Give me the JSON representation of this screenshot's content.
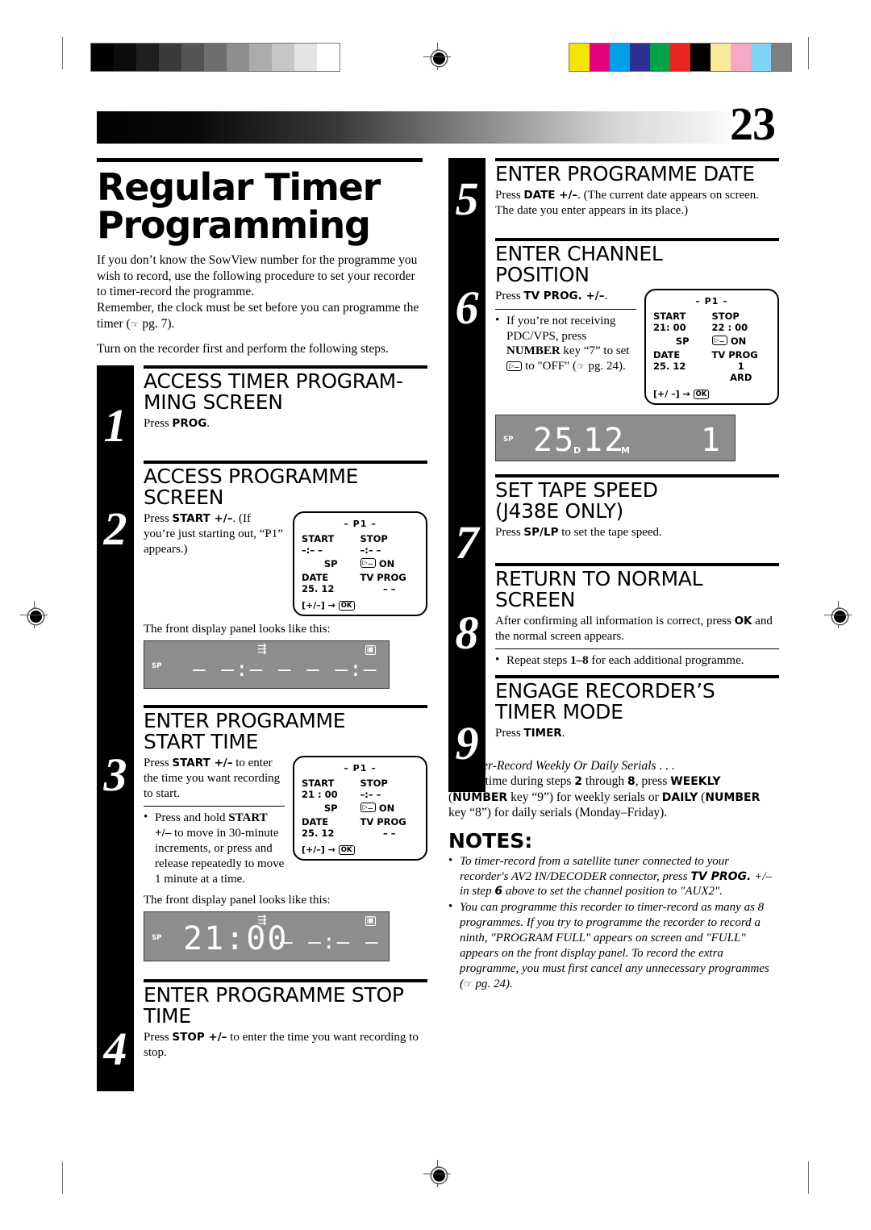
{
  "page": {
    "number": "23",
    "title_line1": "Regular Timer",
    "title_line2": "Programming"
  },
  "intro": {
    "para1": "If you don’t know the SowView number for the programme you wish to record, use the following procedure to set your recorder to timer-record the programme.",
    "para2": "Remember, the clock must be set before you can programme the timer (",
    "para2_ref": "pg. 7).",
    "para3": "Turn on the recorder first and perform the following steps."
  },
  "steps": [
    {
      "num": "1",
      "heading": "ACCESS TIMER PROGRAM-\nMING SCREEN",
      "body_pre": "Press ",
      "body_bold": "PROG",
      "body_post": "."
    },
    {
      "num": "2",
      "heading": "ACCESS PROGRAMME\nSCREEN",
      "body_pre": "Press ",
      "body_bold": "START +/–",
      "body_post": ". (If you’re just starting out, “P1” appears.)",
      "caption": "The front display panel looks like this:"
    },
    {
      "num": "3",
      "heading": "ENTER PROGRAMME\nSTART TIME",
      "body_pre": "Press ",
      "body_bold": "START +/–",
      "body_post": " to enter the time you want recording to start.",
      "bullet_pre": "Press and hold ",
      "bullet_bold": "START +/–",
      "bullet_post": " to move in 30-minute increments, or press and release repeatedly to move 1 minute at a time.",
      "caption": "The front display panel looks like this:"
    },
    {
      "num": "4",
      "heading": "ENTER PROGRAMME STOP\nTIME",
      "body_pre": "Press ",
      "body_bold": "STOP +/–",
      "body_post": " to enter the time you want recording to stop."
    },
    {
      "num": "5",
      "heading": "ENTER PROGRAMME DATE",
      "body_pre": "Press ",
      "body_bold": "DATE +/–",
      "body_post": ". (The current date appears on screen. The date you enter appears in its place.)"
    },
    {
      "num": "6",
      "heading": "ENTER CHANNEL\nPOSITION",
      "body_pre": "Press ",
      "body_bold": "TV PROG. +/–",
      "body_post": ".",
      "bullet_pre": "If you’re not receiving PDC/VPS, press ",
      "bullet_bold": "NUMBER",
      "bullet_post": " key “7” to set",
      "bullet_post2": "to \"OFF\" (",
      "bullet_ref": "pg. 24)."
    },
    {
      "num": "7",
      "heading": "SET TAPE SPEED\n(J438E ONLY)",
      "body_pre": "Press ",
      "body_bold": "SP/LP",
      "body_post": " to set the tape speed."
    },
    {
      "num": "8",
      "heading": "RETURN TO NORMAL\nSCREEN",
      "body_pre": "After confirming all information is correct, press ",
      "body_bold": "OK",
      "body_post": " and the normal screen appears.",
      "bullet_pre": "Repeat steps ",
      "bullet_bold": "1–8",
      "bullet_post": " for each additional programme."
    },
    {
      "num": "9",
      "heading": "ENGAGE RECORDER’S\nTIMER MODE",
      "body_pre": "Press ",
      "body_bold": "TIMER",
      "body_post": "."
    }
  ],
  "osd_step2": {
    "title": "– P1 –",
    "start_label": "START",
    "start_value": "–:– –",
    "stop_label": "STOP",
    "stop_value": "–:– –",
    "speed": "SP",
    "tape_icon": "tape-icon",
    "on_label": "ON",
    "date_label": "DATE",
    "date_value": "25. 12",
    "tvprog_label": "TV  PROG",
    "tvprog_value": "– –",
    "footer": "[+/–] →",
    "footer_icon": "OK"
  },
  "osd_step3": {
    "title": "– P1 –",
    "start_label": "START",
    "start_value": "21 : 00",
    "stop_label": "STOP",
    "stop_value": "–:– –",
    "speed": "SP",
    "tape_icon": "tape-icon",
    "on_label": "ON",
    "date_label": "DATE",
    "date_value": "25. 12",
    "tvprog_label": "TV  PROG",
    "tvprog_value": "– –",
    "footer": "[+/–] →",
    "footer_icon": "OK"
  },
  "osd_step6": {
    "title": "– P1 –",
    "start_label": "START",
    "start_value": "21: 00",
    "stop_label": "STOP",
    "stop_value": "22 : 00",
    "speed": "SP",
    "tape_icon": "tape-icon",
    "on_label": "ON",
    "date_label": "DATE",
    "date_value": "25. 12",
    "tvprog_label": "TV  PROG",
    "tvprog_value": "1",
    "tvprog_value2": "ARD",
    "footer": "[+/ –] →",
    "footer_icon": "OK"
  },
  "lcd_step2": {
    "sp": "SP",
    "arrow": "arrow-right-icon",
    "cassette": "cassette-icon",
    "segments": "– –:– –   – –:– –  – –"
  },
  "lcd_step3": {
    "sp": "SP",
    "arrow": "arrow-right-icon",
    "cassette": "cassette-icon",
    "time": "21:00",
    "segments": "– –:– –"
  },
  "lcd_step6": {
    "sp": "SP",
    "day": "25",
    "day_unit": "D",
    "month": "12",
    "month_unit": "M",
    "channel": "1"
  },
  "serials": {
    "title": "To Timer-Record Weekly Or Daily Serials . . .",
    "part1": ". . . anytime during steps ",
    "b1": "2",
    "part2": " through ",
    "b2": "8",
    "part3": ", press ",
    "b3": "WEEKLY",
    "part4": " (",
    "b4": "NUMBER",
    "part5": " key “9”) for weekly serials or ",
    "b5": "DAILY",
    "part6": " (",
    "b6": "NUMBER",
    "part7": " key “8”) for daily serials (Monday–Friday)."
  },
  "notes": {
    "heading": "NOTES:",
    "note1_a": "To timer-record from a satellite tuner connected to your recorder's AV2 IN/DECODER connector, press ",
    "note1_b": "TV PROG.",
    "note1_c": " +/– in step ",
    "note1_d": "6",
    "note1_e": " above to set the channel position to \"AUX2\".",
    "note2_a": "You can programme this recorder to timer-record as many as 8 programmes. If you try to programme the recorder to record a ninth, \"PROGRAM FULL\" appears on screen and \"FULL\" appears on the front display panel. To record the extra programme, you must first cancel any unnecessary programmes (",
    "note2_ref": "pg. 24)."
  },
  "calibration": {
    "gray_steps": [
      "#000000",
      "#0d0d0d",
      "#1f1f1f",
      "#3a3a3a",
      "#545454",
      "#6f6f6f",
      "#8e8e8e",
      "#ababab",
      "#c6c6c6",
      "#e4e4e4",
      "#ffffff"
    ],
    "color_steps": [
      "#f5e400",
      "#e6007e",
      "#00a0e9",
      "#2e3192",
      "#00a24b",
      "#e8251f",
      "#000000",
      "#faeb9b",
      "#f6a8c4",
      "#7fd3f5",
      "#808080"
    ]
  }
}
